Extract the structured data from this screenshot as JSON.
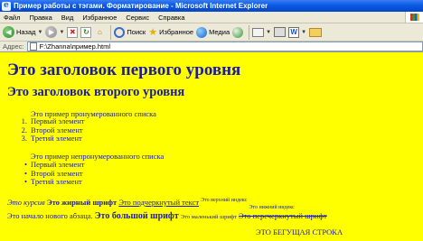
{
  "window": {
    "title": "Пример работы с тэгами. Форматирование - Microsoft Internet Explorer"
  },
  "menu": [
    "Файл",
    "Правка",
    "Вид",
    "Избранное",
    "Сервис",
    "Справка"
  ],
  "toolbar": {
    "back": "Назад",
    "search": "Поиск",
    "favorites": "Избранное",
    "media": "Медиа"
  },
  "address": {
    "label": "Адрес:",
    "value": "F:\\Zhanna\\пример.html"
  },
  "page": {
    "h1": "Это заголовок первого уровня",
    "h2": "Это заголовок второго уровня",
    "ordered_caption": "Это пример пронумерованного списка",
    "ordered_items": [
      {
        "marker": "1.",
        "text": "Первый элемент"
      },
      {
        "marker": "2.",
        "text": "Второй элемент"
      },
      {
        "marker": "3.",
        "text": "Третий элемент"
      }
    ],
    "unordered_caption": "Это пример непронумерованного списка",
    "unordered_items": [
      "Первый элемент",
      "Второй элемент",
      "Третий элемент"
    ],
    "line1": {
      "italic": "Это курсив",
      "bold": "Это жирный шрифт",
      "underline": "Это подчеркнутый текст",
      "superscript": "Это верхний индекс",
      "subscript": "Это нижний индекс"
    },
    "line2": {
      "new_paragraph": "Это начало нового абзаца.",
      "big": "Это большой шрифт",
      "small": "Это маленький шрифт",
      "strike": "Это перечеркнутый шрифт"
    },
    "marquee": "ЭТО БЕГУЩАЯ СТРОКА"
  },
  "colors": {
    "background": "#ffff00",
    "text": "#1c1c9c"
  }
}
